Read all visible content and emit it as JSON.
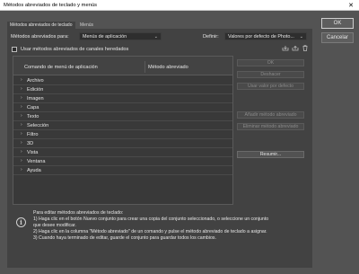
{
  "window": {
    "title": "Métodos abreviados de teclado y menús",
    "close_glyph": "✕"
  },
  "tabs": [
    {
      "label": "Métodos abreviados de teclado"
    },
    {
      "label": "Menús"
    }
  ],
  "controls": {
    "set_label": "Métodos abreviados para:",
    "set_value": "Menús de aplicación",
    "define_label": "Definir:",
    "define_value": "Valores por defecto de Photo...",
    "chevron": "⌄",
    "legacy_checkbox_label": "Usar métodos abreviados de canales heredados"
  },
  "table": {
    "col_command": "Comando de menú de aplicación",
    "col_shortcut": "Método abreviado",
    "rows": [
      "Archivo",
      "Edición",
      "Imagen",
      "Capa",
      "Texto",
      "Selección",
      "Filtro",
      "3D",
      "Vista",
      "Ventana",
      "Ayuda"
    ],
    "expand_glyph": "›"
  },
  "side_buttons": {
    "ok": "OK",
    "undo": "Deshacer",
    "use_default": "Usar valor por defecto",
    "add_shortcut": "Añadir método abreviado",
    "remove_shortcut": "Eliminar método abreviado",
    "summarize": "Resumir..."
  },
  "info": {
    "icon_glyph": "i",
    "lines": [
      "Para editar métodos abreviados de teclado:",
      "1) Haga clic en el botón Nuevo conjunto para crear una copia del conjunto seleccionado, o seleccione un conjunto",
      "que desee modificar.",
      "2) Haga clic en la columna \"Método abreviado\" de un comando y pulse el método abreviado de teclado a asignar.",
      "3) Cuando haya terminado de editar, guarde el conjunto para guardar todos los cambios."
    ]
  },
  "dialog_buttons": {
    "ok": "OK",
    "cancel": "Cancelar"
  },
  "colors": {
    "bg": "#535353",
    "panel": "#424242",
    "field": "#2e2e2e"
  }
}
